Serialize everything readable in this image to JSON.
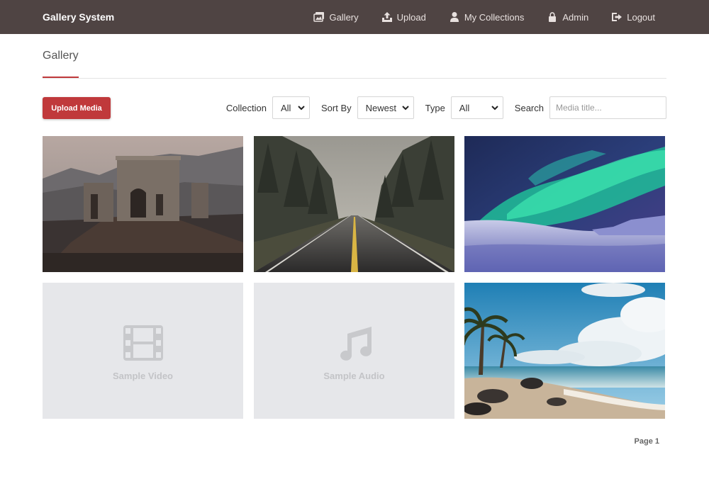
{
  "navbar": {
    "brand": "Gallery System",
    "links": [
      {
        "label": "Gallery",
        "icon": "images-icon"
      },
      {
        "label": "Upload",
        "icon": "upload-icon"
      },
      {
        "label": "My Collections",
        "icon": "user-icon"
      },
      {
        "label": "Admin",
        "icon": "lock-icon"
      },
      {
        "label": "Logout",
        "icon": "logout-icon"
      }
    ]
  },
  "page": {
    "title": "Gallery"
  },
  "toolbar": {
    "upload_label": "Upload Media",
    "collection_label": "Collection",
    "collection_value": "All",
    "sort_label": "Sort By",
    "sort_value": "Newest",
    "type_label": "Type",
    "type_value": "All",
    "search_label": "Search",
    "search_placeholder": "Media title..."
  },
  "gallery": {
    "items": [
      {
        "kind": "image",
        "scene": "ruins"
      },
      {
        "kind": "image",
        "scene": "forest-road"
      },
      {
        "kind": "image",
        "scene": "aurora"
      },
      {
        "kind": "video",
        "label": "Sample Video",
        "icon": "film-icon"
      },
      {
        "kind": "audio",
        "label": "Sample Audio",
        "icon": "music-note-icon"
      },
      {
        "kind": "image",
        "scene": "beach"
      }
    ]
  },
  "pagination": {
    "label": "Page 1"
  },
  "colors": {
    "navbar": "#4f4443",
    "accent": "#c0393b",
    "placeholder": "#e6e7ea"
  }
}
